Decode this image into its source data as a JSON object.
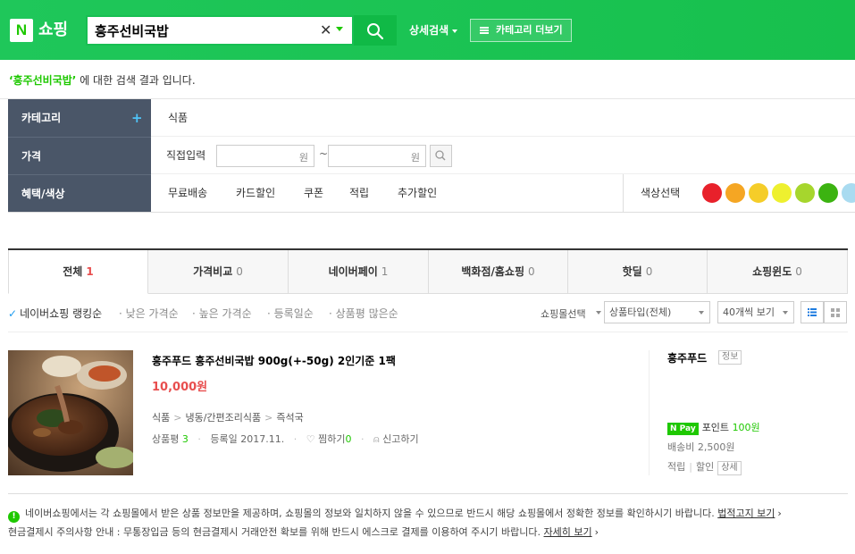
{
  "header": {
    "logo_letter": "N",
    "logo_text": "쇼핑",
    "search_value": "흥주선비국밥",
    "detail_search": "상세검색",
    "category_more": "카테고리 더보기"
  },
  "result": {
    "keyword": "‘흥주선비국밥’",
    "suffix": "에 대한 검색 결과 입니다."
  },
  "filter": {
    "category_label": "카테고리",
    "category_plus": "+",
    "category_value": "식품",
    "price_label": "가격",
    "price_direct": "직접입력",
    "price_unit_min": "원",
    "price_tilde": "~",
    "price_unit_max": "원",
    "benefit_label": "혜택/색상",
    "benefits": [
      "무료배송",
      "카드할인",
      "쿠폰",
      "적립",
      "추가할인"
    ],
    "color_label": "색상선택",
    "colors": [
      "#e8212b",
      "#f5a623",
      "#f5cd29",
      "#eef02f",
      "#a6d62d",
      "#3cb311",
      "#a9dbf0"
    ]
  },
  "tabs": [
    {
      "label": "전체",
      "count": "1"
    },
    {
      "label": "가격비교",
      "count": "0"
    },
    {
      "label": "네이버페이",
      "count": "1"
    },
    {
      "label": "백화점/홈쇼핑",
      "count": "0"
    },
    {
      "label": "핫딜",
      "count": "0"
    },
    {
      "label": "쇼핑윈도",
      "count": "0"
    }
  ],
  "sort": {
    "options": [
      "네이버쇼핑 랭킹순",
      "낮은 가격순",
      "높은 가격순",
      "등록일순",
      "상품평 많은순"
    ],
    "mall_select": "쇼핑몰선택",
    "product_type": "상품타입(전체)",
    "page_size": "40개씩 보기"
  },
  "product": {
    "title": "흥주푸드 흥주선비국밥 900g(+-50g) 2인기준 1팩",
    "price": "10,000원",
    "category": [
      "식품",
      "냉동/간편조리식품",
      "즉석국"
    ],
    "review_label": "상품평",
    "review_count": "3",
    "reg_label": "등록일",
    "reg_date": "2017.11.",
    "wish_label": "찜하기",
    "wish_count": "0",
    "report": "신고하기",
    "mall": "흥주푸드",
    "mall_info": "정보",
    "npay_badge": "N Pay",
    "point_label": "포인트",
    "point_value": "100원",
    "shipping": "배송비 2,500원",
    "tag_save": "적립",
    "tag_discount": "할인",
    "tag_detail": "상세"
  },
  "notice": {
    "line1": "네이버쇼핑에서는 각 쇼핑몰에서 받은 상품 정보만을 제공하며, 쇼핑몰의 정보와 일치하지 않을 수 있으므로 반드시 해당 쇼핑몰에서 정확한 정보를 확인하시기 바랍니다.",
    "line1_link": "법적고지 보기",
    "line2": "현금결제시 주의사항 안내 : 무통장입금 등의 현금결제시 거래안전 확보를 위해 반드시 에스크로 결제를 이용하여 주시기 바랍니다.",
    "line2_link": "자세히 보기"
  }
}
